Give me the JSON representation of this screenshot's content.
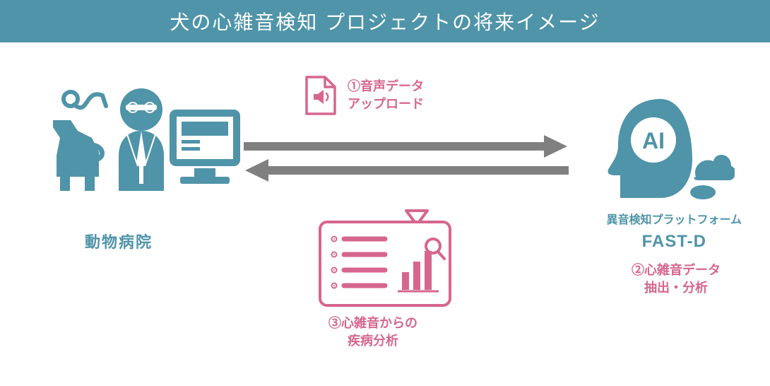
{
  "title": "犬の心雑音検知  プロジェクトの将来イメージ",
  "left": {
    "label": "動物病院"
  },
  "right": {
    "label_line1": "異音検知プラットフォーム",
    "label_big": "FAST-D",
    "step2_line1": "②心雑音データ",
    "step2_line2": "抽出・分析"
  },
  "step1": {
    "line1": "①音声データ",
    "line2": "アップロード"
  },
  "step3": {
    "line1": "③心雑音からの",
    "line2": "疾病分析"
  },
  "ai_label": "AI"
}
